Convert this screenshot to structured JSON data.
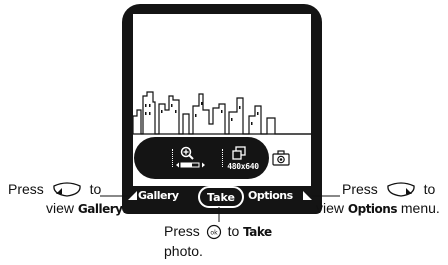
{
  "viewfinder": {
    "resolution": "480x640"
  },
  "softkeys": {
    "left": "Gallery",
    "center": "Take",
    "right": "Options"
  },
  "callouts": {
    "left": {
      "line1_pre": "Press",
      "line1_post": "to",
      "line2_pre": "view",
      "line2_key": "Gallery",
      "line2_post": "."
    },
    "right": {
      "line1_pre": "Press",
      "line1_post": "to",
      "line2_pre": "view",
      "line2_key": "Options",
      "line2_post": "menu."
    },
    "center": {
      "line1_pre": "Press",
      "line1_mid": "to",
      "line1_key": "Take",
      "line2": "photo."
    }
  },
  "icons": {
    "zoom": "zoom-in-icon",
    "resolution": "resolution-icon",
    "camera": "camera-icon",
    "left_key": "left-softkey-icon",
    "right_key": "right-softkey-icon",
    "ok_key": "ok-key-icon"
  }
}
